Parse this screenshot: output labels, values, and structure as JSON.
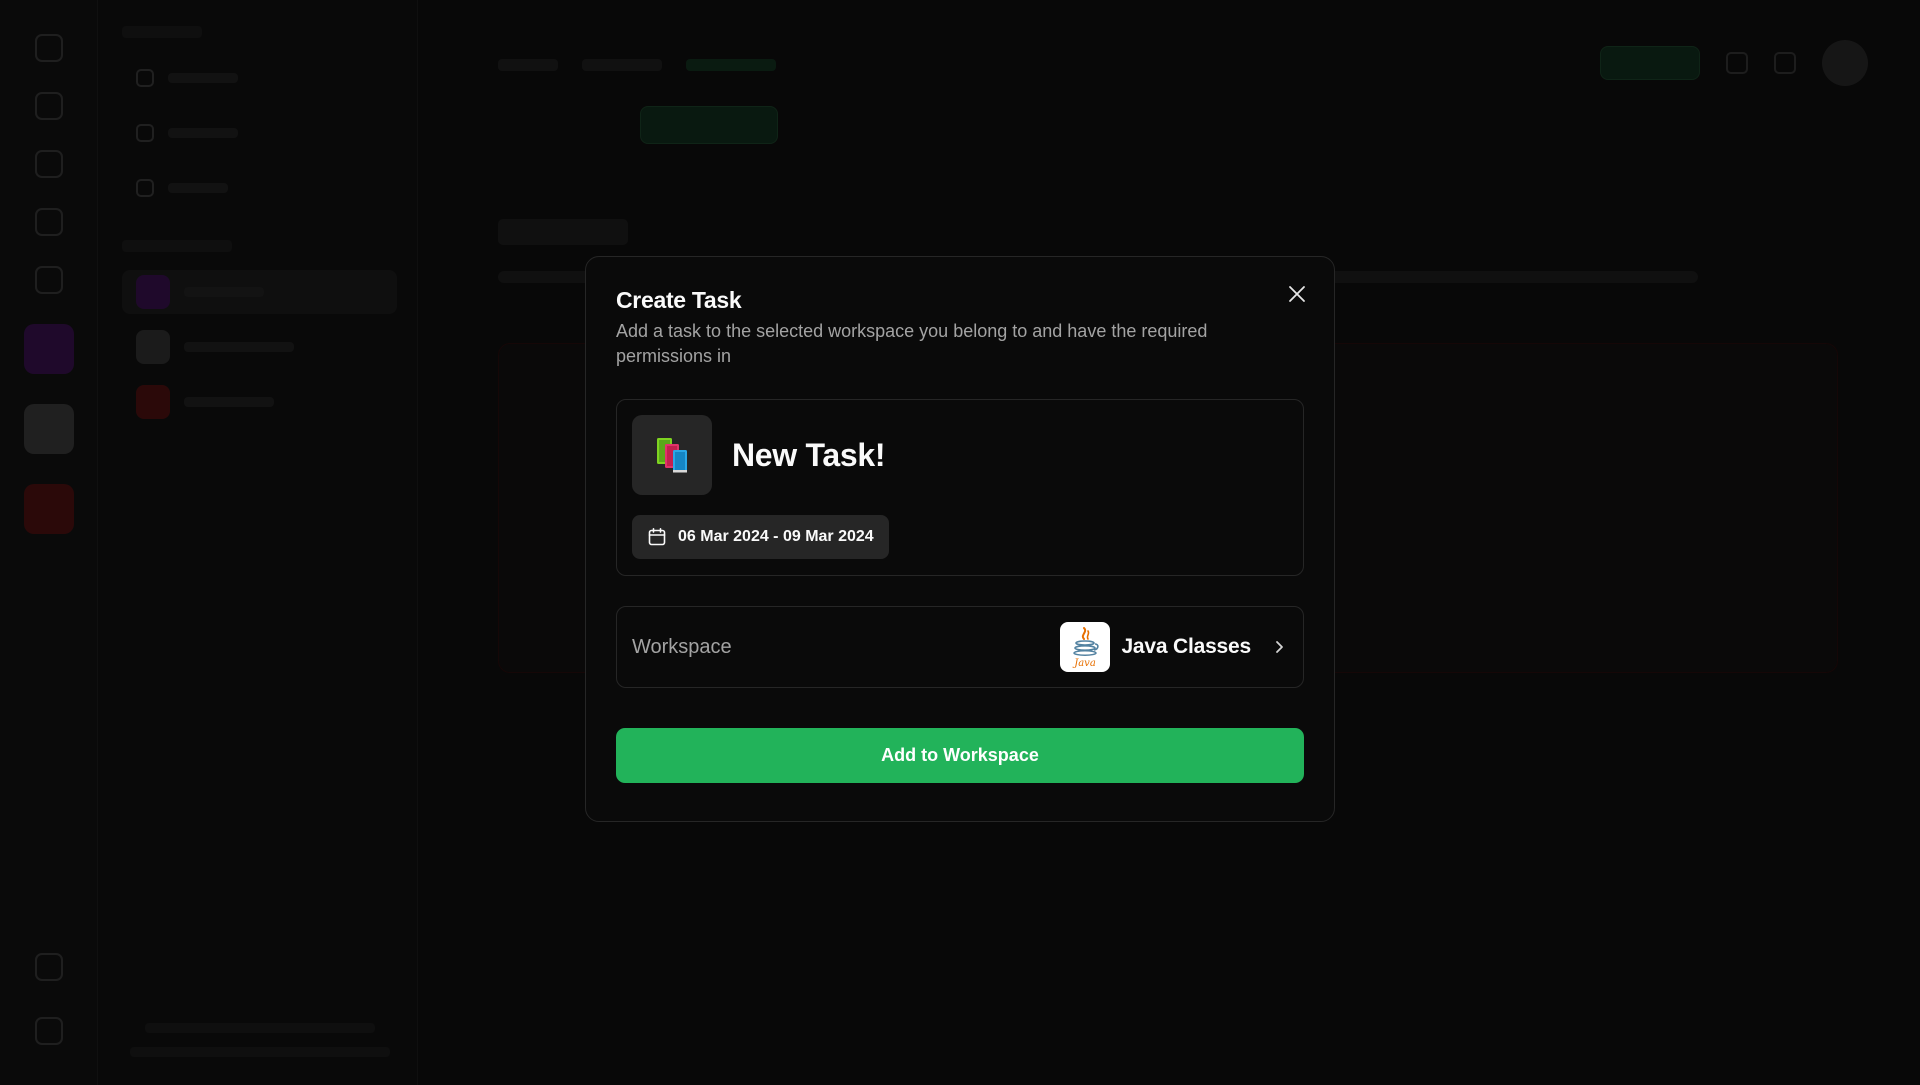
{
  "modal": {
    "title": "Create Task",
    "description": "Add a task to the selected workspace you belong to and have the required permissions in",
    "close_icon": "close-icon"
  },
  "task": {
    "icon": "books-emoji",
    "name": "New Task!",
    "date_range": "06 Mar 2024 - 09 Mar 2024",
    "date_icon": "calendar-icon"
  },
  "workspace_picker": {
    "label": "Workspace",
    "selected": "Java Classes",
    "logo": "java-logo",
    "logo_text": "Java",
    "chevron": "chevron-right-icon"
  },
  "submit": {
    "label": "Add to Workspace",
    "color": "#22b35a"
  },
  "colors": {
    "modal_bg": "#0a0a0a",
    "border": "#262626",
    "muted_text": "#a3a3a3"
  }
}
